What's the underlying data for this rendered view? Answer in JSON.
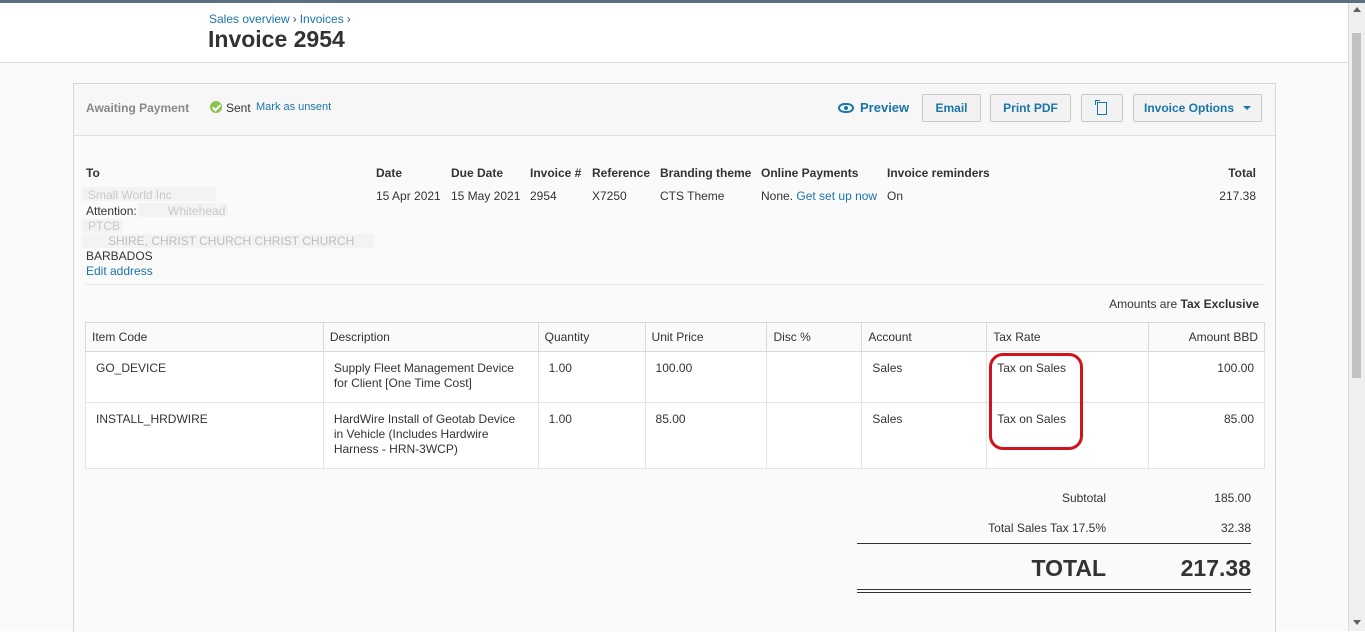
{
  "header": {
    "breadcrumb": [
      "Sales overview",
      "Invoices"
    ],
    "title": "Invoice 2954"
  },
  "toolbar": {
    "status": "Awaiting Payment",
    "sent_label": "Sent",
    "mark_unsent_label": "Mark as unsent",
    "preview_label": "Preview",
    "email_label": "Email",
    "print_label": "Print PDF",
    "copy_icon": "copy-icon",
    "options_label": "Invoice Options"
  },
  "details": {
    "to_label": "To",
    "to_name": "Small World Inc",
    "attention_label": "Attention:",
    "attention_value": "Whitehead",
    "address_line1": "PTCB",
    "address_line2": "SHIRE, CHRIST CHURCH CHRIST CHURCH",
    "country": "BARBADOS",
    "edit_address": "Edit address",
    "date_label": "Date",
    "date_value": "15 Apr 2021",
    "due_label": "Due Date",
    "due_value": "15 May 2021",
    "invoice_label": "Invoice #",
    "invoice_value": "2954",
    "reference_label": "Reference",
    "reference_value": "X7250",
    "branding_label": "Branding theme",
    "branding_value": "CTS Theme",
    "online_label": "Online Payments",
    "online_value": "None.",
    "online_link": "Get set up now",
    "reminders_label": "Invoice reminders",
    "reminders_value": "On",
    "total_label": "Total",
    "total_value": "217.38"
  },
  "amounts_note": {
    "prefix": "Amounts are",
    "value": "Tax Exclusive"
  },
  "table": {
    "headers": [
      "Item Code",
      "Description",
      "Quantity",
      "Unit Price",
      "Disc %",
      "Account",
      "Tax Rate",
      "Amount BBD"
    ],
    "rows": [
      {
        "code": "GO_DEVICE",
        "description": "Supply Fleet Management Device for Client [One Time Cost]",
        "quantity": "1.00",
        "unit_price": "100.00",
        "disc": "",
        "account": "Sales",
        "tax_rate": "Tax on Sales",
        "amount": "100.00"
      },
      {
        "code": "INSTALL_HRDWIRE",
        "description": "HardWire Install of Geotab Device in Vehicle (Includes Hardwire Harness - HRN-3WCP)",
        "quantity": "1.00",
        "unit_price": "85.00",
        "disc": "",
        "account": "Sales",
        "tax_rate": "Tax on Sales",
        "amount": "85.00"
      }
    ]
  },
  "summary": {
    "subtotal_label": "Subtotal",
    "subtotal_value": "185.00",
    "tax_label": "Total Sales Tax 17.5%",
    "tax_value": "32.38",
    "total_label": "TOTAL",
    "total_value": "217.38"
  },
  "colors": {
    "link": "#1a75a8",
    "highlight": "#d0141b",
    "sent_icon": "#8bc34a"
  }
}
